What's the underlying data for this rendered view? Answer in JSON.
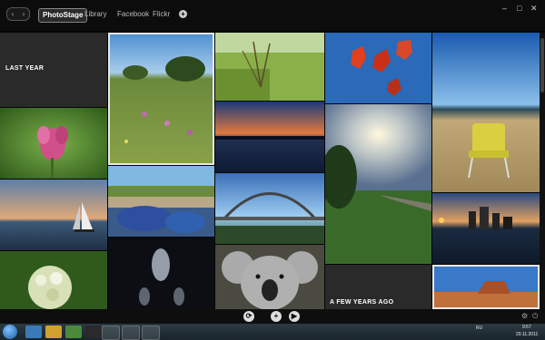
{
  "toolbar": {
    "back": "‹",
    "forward": "›",
    "tabs": [
      "PhotoStage",
      "Library",
      "Facebook",
      "Flickr"
    ],
    "add": "+"
  },
  "window": {
    "minimize": "–",
    "maximize": "□",
    "close": "✕"
  },
  "gallery": {
    "last_year_label": "LAST YEAR",
    "few_years_ago_label": "A FEW YEARS AGO"
  },
  "controls": {
    "rotate": "⟳",
    "add": "+",
    "play": "▶"
  },
  "taskbar": {
    "language": "RU",
    "time": "9:57",
    "date": "20.11.2011"
  }
}
